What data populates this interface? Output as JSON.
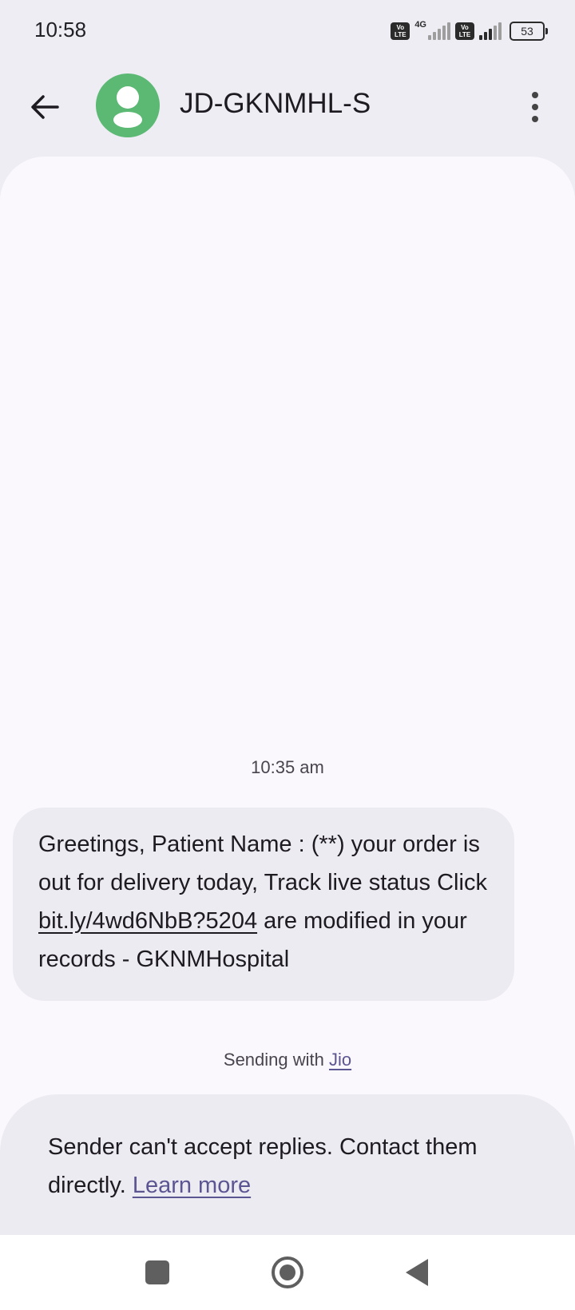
{
  "status_bar": {
    "time": "10:58",
    "volte_label": "Vo\nLTE",
    "network_type": "4G",
    "battery": "53"
  },
  "header": {
    "back_icon": "arrow-left-icon",
    "contact_name": "JD-GKNMHL-S",
    "menu_icon": "more-vertical-icon",
    "avatar_color": "#5BB974"
  },
  "conversation": {
    "timestamp": "10:35 am",
    "message": {
      "text_before_link": "Greetings, Patient Name : (**) your order is out for delivery today, Track live status Click ",
      "link": "bit.ly/4wd6NbB?5204",
      "text_after_link": " are modified in your records - GKNMHospital"
    },
    "sending_prefix": "Sending with ",
    "carrier_link": "Jio"
  },
  "compose_notice": {
    "text": "Sender can't accept replies. Contact them directly. ",
    "link": "Learn more"
  },
  "nav_bar": {
    "recents_icon": "square-icon",
    "home_icon": "circle-icon",
    "back_icon": "triangle-back-icon"
  },
  "colors": {
    "background": "#EEEDF4",
    "conversation_bg": "#FBF8FD",
    "bubble_bg": "#EDEBF2",
    "link_accent": "#5B5592"
  }
}
